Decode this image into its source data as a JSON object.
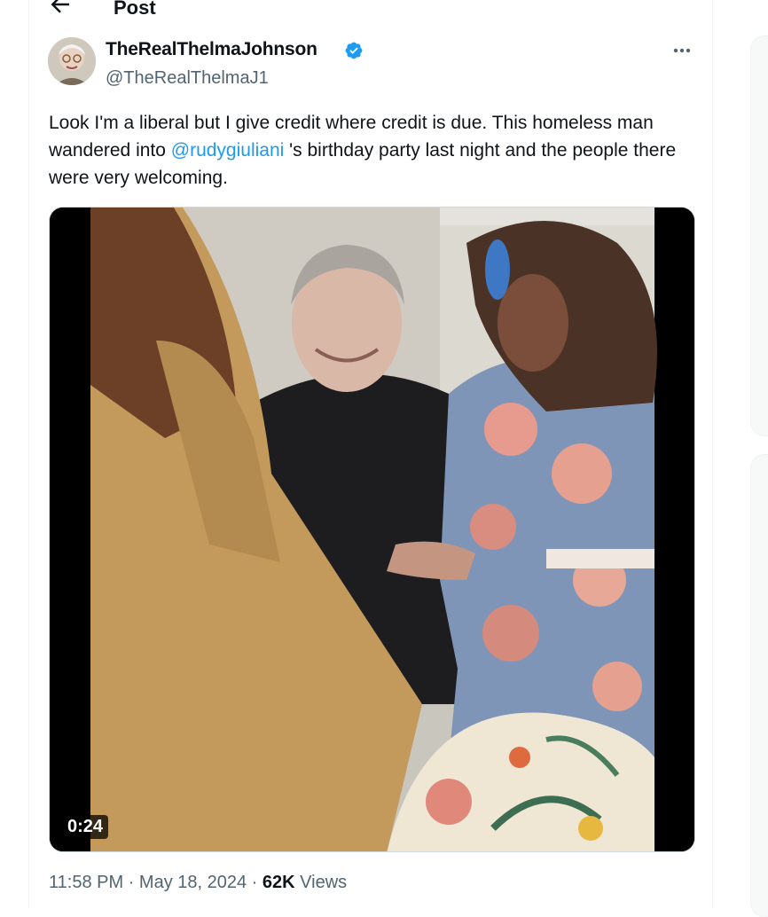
{
  "header": {
    "title": "Post",
    "back_icon": "arrow-left-icon"
  },
  "author": {
    "display_name": "TheRealThelmaJohnson",
    "handle": "@TheRealThelmaJ1",
    "verified": true,
    "verified_color": "#1d9bf0"
  },
  "tweet": {
    "text_before": "Look I'm a liberal but I give credit where credit is due.  This homeless man wandered into ",
    "mention": "@rudygiuliani",
    "text_after": " 's birthday party last night and the people there were very welcoming.",
    "video_duration": "0:24"
  },
  "meta": {
    "time": "11:58 PM",
    "sep1": " · ",
    "date": "May 18, 2024",
    "sep2": " · ",
    "views_count": "62K",
    "views_label": " Views"
  },
  "colors": {
    "accent": "#1d9bf0",
    "secondary_text": "#536471"
  }
}
